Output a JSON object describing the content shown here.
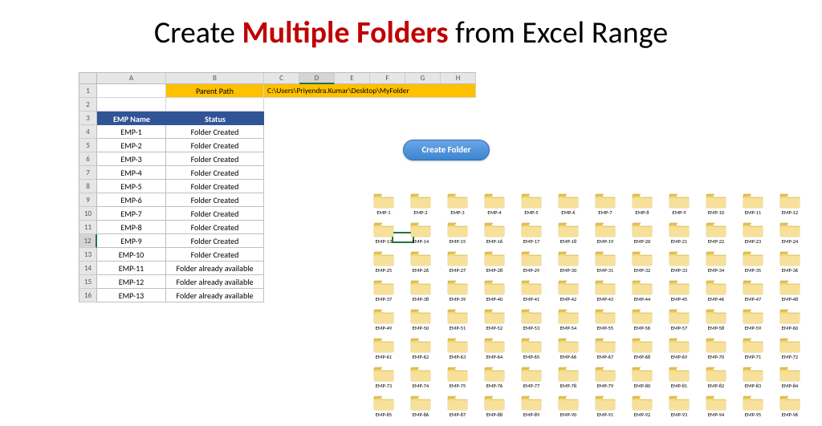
{
  "title": {
    "pre": "Create ",
    "highlight": "Multiple Folders",
    "post": " from Excel Range"
  },
  "sheet": {
    "columns": [
      "A",
      "B",
      "C",
      "D",
      "E",
      "F",
      "G",
      "H"
    ],
    "selected_col": "D",
    "selected_row": "12",
    "row_count": 16,
    "row1": {
      "B": "Parent Path",
      "path": "C:\\Users\\Priyendra.Kumar\\Desktop\\MyFolder"
    },
    "headers": {
      "A": "EMP Name",
      "B": "Status"
    },
    "data": [
      {
        "r": 4,
        "name": "EMP-1",
        "status": "Folder Created"
      },
      {
        "r": 5,
        "name": "EMP-2",
        "status": "Folder Created"
      },
      {
        "r": 6,
        "name": "EMP-3",
        "status": "Folder Created"
      },
      {
        "r": 7,
        "name": "EMP-4",
        "status": "Folder Created"
      },
      {
        "r": 8,
        "name": "EMP-5",
        "status": "Folder Created"
      },
      {
        "r": 9,
        "name": "EMP-6",
        "status": "Folder Created"
      },
      {
        "r": 10,
        "name": "EMP-7",
        "status": "Folder Created"
      },
      {
        "r": 11,
        "name": "EMP-8",
        "status": "Folder Created"
      },
      {
        "r": 12,
        "name": "EMP-9",
        "status": "Folder Created"
      },
      {
        "r": 13,
        "name": "EMP-10",
        "status": "Folder Created"
      },
      {
        "r": 14,
        "name": "EMP-11",
        "status": "Folder already available"
      },
      {
        "r": 15,
        "name": "EMP-12",
        "status": "Folder already available"
      },
      {
        "r": 16,
        "name": "EMP-13",
        "status": "Folder already available"
      }
    ]
  },
  "button": {
    "label": "Create Folder"
  },
  "folders": {
    "prefix": "EMP-",
    "count": 96
  }
}
